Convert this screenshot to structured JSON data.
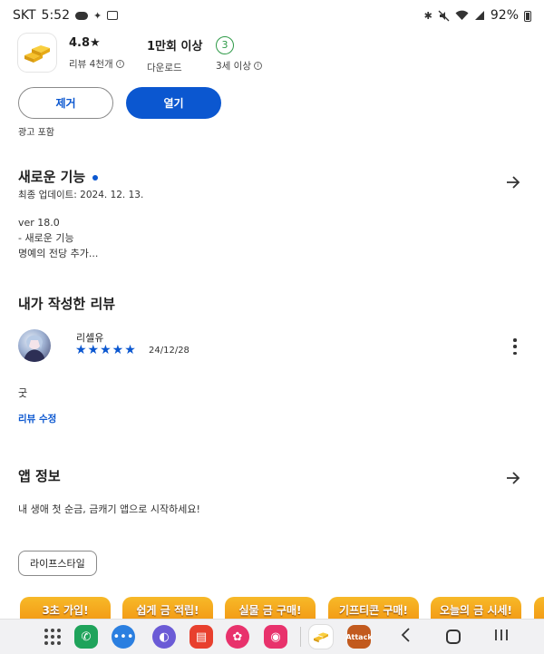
{
  "status_bar": {
    "carrier": "SKT",
    "time": "5:52",
    "battery": "92%",
    "icons": [
      "chat-bubble-icon",
      "nearby-share-icon",
      "media-icon",
      "bluetooth-icon",
      "mute-icon",
      "wifi-icon",
      "signal-icon",
      "battery-icon"
    ]
  },
  "app_summary": {
    "rating": "4.8★",
    "reviews_label": "리뷰 4천개",
    "downloads": "1만회 이상",
    "downloads_label": "다운로드",
    "age_rating": "3",
    "age_label": "3세 이상"
  },
  "actions": {
    "uninstall": "제거",
    "open": "열기",
    "ads_note": "광고 포함"
  },
  "whats_new": {
    "title": "새로운 기능",
    "updated": "최종 업데이트: 2024. 12. 13.",
    "lines": [
      "ver 18.0",
      "- 새로운 기능",
      "명예의 전당 추가..."
    ]
  },
  "my_review": {
    "title": "내가 작성한 리뷰",
    "reviewer": "리셀유",
    "stars": "★★★★★",
    "rating_value": 5,
    "date": "24/12/28",
    "text": "굿",
    "edit": "리뷰 수정"
  },
  "app_info": {
    "title": "앱 정보",
    "description": "내 생애 첫 순금, 금캐기 앱으로 시작하세요!",
    "category": "라이프스타일"
  },
  "banners": [
    "3초 가입!",
    "쉽게 금 적립!",
    "실물 금 구매!",
    "기프티콘 구매!",
    "오늘의 금 시세!"
  ],
  "navbar": {
    "apps": [
      "phone-icon",
      "messages-icon",
      "internet-icon",
      "notes-icon",
      "gallery-icon",
      "camera-icon"
    ],
    "recent_app_label": "Attack",
    "colors": {
      "phone": "#1fa35b",
      "messages": "#2b7fe0",
      "internet": "#6b5bd6",
      "notes": "#e8402e",
      "gallery": "#e8326c",
      "camera": "#e8326c",
      "accent": "#0b57d0",
      "age_green": "#2e9a47"
    }
  }
}
